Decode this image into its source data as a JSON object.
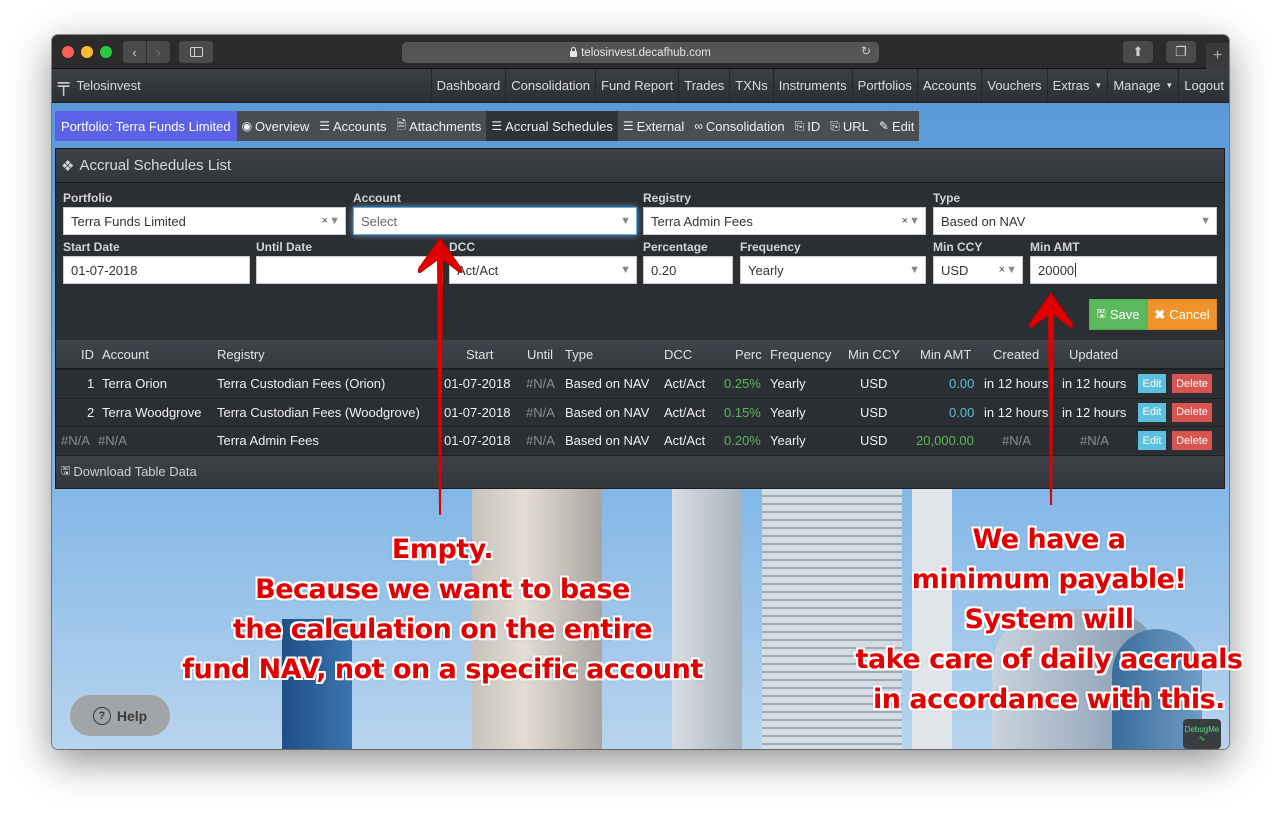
{
  "browser": {
    "url": "telosinvest.decafhub.com"
  },
  "navbar": {
    "brand": "Telosinvest",
    "items": [
      {
        "label": "Dashboard"
      },
      {
        "label": "Consolidation"
      },
      {
        "label": "Fund Report"
      },
      {
        "label": "Trades"
      },
      {
        "label": "TXNs"
      },
      {
        "label": "Instruments"
      },
      {
        "label": "Portfolios"
      },
      {
        "label": "Accounts"
      },
      {
        "label": "Vouchers"
      },
      {
        "label": "Extras",
        "dropdown": true
      },
      {
        "label": "Manage",
        "dropdown": true
      },
      {
        "label": "Logout"
      }
    ]
  },
  "subnav": {
    "portfolio": "Portfolio: Terra Funds Limited",
    "items": [
      {
        "label": "Overview",
        "icon": "eye-icon"
      },
      {
        "label": "Accounts",
        "icon": "list-icon"
      },
      {
        "label": "Attachments",
        "icon": "file-icon"
      },
      {
        "label": "Accrual Schedules",
        "icon": "list-icon",
        "active": true
      },
      {
        "label": "External",
        "icon": "list-icon"
      },
      {
        "label": "Consolidation",
        "icon": "link-icon"
      },
      {
        "label": "ID",
        "icon": "copy-icon"
      },
      {
        "label": "URL",
        "icon": "copy-icon"
      },
      {
        "label": "Edit",
        "icon": "edit-icon"
      }
    ]
  },
  "panel": {
    "title": "Accrual Schedules List"
  },
  "form": {
    "portfolio": {
      "label": "Portfolio",
      "value": "Terra Funds Limited"
    },
    "account": {
      "label": "Account",
      "placeholder": "Select"
    },
    "registry": {
      "label": "Registry",
      "value": "Terra Admin Fees"
    },
    "type": {
      "label": "Type",
      "value": "Based on NAV"
    },
    "start_date": {
      "label": "Start Date",
      "value": "01-07-2018"
    },
    "until_date": {
      "label": "Until Date",
      "value": ""
    },
    "dcc": {
      "label": "DCC",
      "value": "Act/Act"
    },
    "percentage": {
      "label": "Percentage",
      "value": "0.20"
    },
    "frequency": {
      "label": "Frequency",
      "value": "Yearly"
    },
    "min_ccy": {
      "label": "Min CCY",
      "value": "USD"
    },
    "min_amt": {
      "label": "Min AMT",
      "value": "20000"
    },
    "save_label": "Save",
    "cancel_label": "Cancel"
  },
  "table": {
    "headers": [
      "ID",
      "Account",
      "Registry",
      "Start",
      "Until",
      "Type",
      "DCC",
      "Perc",
      "Frequency",
      "Min CCY",
      "Min AMT",
      "Created",
      "Updated"
    ],
    "rows": [
      {
        "id": "1",
        "account": "Terra Orion",
        "registry": "Terra Custodian Fees (Orion)",
        "start": "01-07-2018",
        "until": "#N/A",
        "type": "Based on NAV",
        "dcc": "Act/Act",
        "perc": "0.25%",
        "frequency": "Yearly",
        "min_ccy": "USD",
        "min_amt": "0.00",
        "created": "in 12 hours",
        "updated": "in 12 hours"
      },
      {
        "id": "2",
        "account": "Terra Woodgrove",
        "registry": "Terra Custodian Fees (Woodgrove)",
        "start": "01-07-2018",
        "until": "#N/A",
        "type": "Based on NAV",
        "dcc": "Act/Act",
        "perc": "0.15%",
        "frequency": "Yearly",
        "min_ccy": "USD",
        "min_amt": "0.00",
        "created": "in 12 hours",
        "updated": "in 12 hours"
      },
      {
        "id": "#N/A",
        "account": "#N/A",
        "registry": "Terra Admin Fees",
        "start": "01-07-2018",
        "until": "#N/A",
        "type": "Based on NAV",
        "dcc": "Act/Act",
        "perc": "0.20%",
        "frequency": "Yearly",
        "min_ccy": "USD",
        "min_amt": "20,000.00",
        "created": "#N/A",
        "updated": "#N/A"
      }
    ],
    "edit_label": "Edit",
    "delete_label": "Delete",
    "download_label": "Download Table Data"
  },
  "help_label": "Help",
  "debugme_label": "DebugMe",
  "annotations": {
    "left": [
      "Empty.",
      "Because we want to base",
      "the calculation on the entire",
      "fund NAV, not on a specific account"
    ],
    "right": [
      "We have a",
      "minimum payable!",
      "System will",
      "take care of daily accruals",
      "in accordance with this."
    ],
    "color": "#e00000"
  }
}
